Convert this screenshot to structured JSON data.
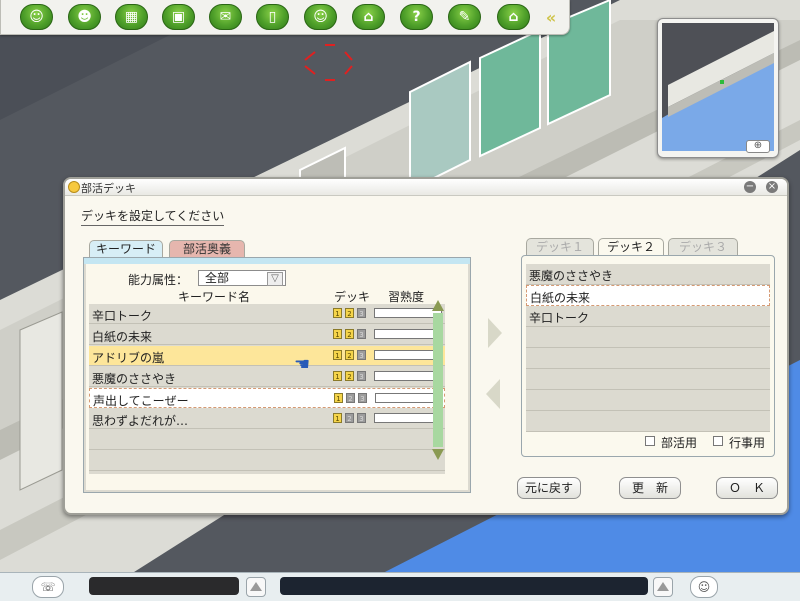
{
  "toolbar": {
    "buttons": [
      {
        "name": "student-icon",
        "glyph": "☺"
      },
      {
        "name": "person-icon",
        "glyph": "☻"
      },
      {
        "name": "clapper-icon",
        "glyph": "▦"
      },
      {
        "name": "box-icon",
        "glyph": "▣"
      },
      {
        "name": "chat-icon",
        "glyph": "✉"
      },
      {
        "name": "phone-icon",
        "glyph": "▯"
      },
      {
        "name": "pair-icon",
        "glyph": "☺"
      },
      {
        "name": "school-icon",
        "glyph": "⌂"
      },
      {
        "name": "help-icon",
        "glyph": "?"
      },
      {
        "name": "tools-icon",
        "glyph": "✎"
      },
      {
        "name": "home-icon",
        "glyph": "⌂"
      }
    ],
    "collapse_glyph": "«"
  },
  "dialog": {
    "title": "部活デッキ",
    "minimize_glyph": "−",
    "close_glyph": "×",
    "instruction": "デッキを設定してください",
    "left_tabs": {
      "keyword": "キーワード",
      "secret": "部活奥義"
    },
    "attribute_label": "能力属性：",
    "attribute_value": "全部",
    "dropdown_glyph": "▽",
    "columns": {
      "name": "キーワード名",
      "deck": "デッキ",
      "proficiency": "習熟度"
    },
    "keywords": [
      {
        "name": "辛口トーク",
        "decks": [
          true,
          true,
          false
        ]
      },
      {
        "name": "白紙の未来",
        "decks": [
          true,
          true,
          false
        ]
      },
      {
        "name": "アドリブの嵐",
        "decks": [
          true,
          true,
          false
        ]
      },
      {
        "name": "悪魔のささやき",
        "decks": [
          true,
          true,
          false
        ]
      },
      {
        "name": "声出してこーぜー",
        "decks": [
          true,
          false,
          false
        ]
      },
      {
        "name": "思わずよだれが…",
        "decks": [
          true,
          false,
          false
        ]
      }
    ],
    "badge_labels": [
      "1",
      "2",
      "3"
    ],
    "deck_tabs": [
      "デッキ１",
      "デッキ２",
      "デッキ３"
    ],
    "deck_items": [
      "悪魔のささやき",
      "白紙の未来",
      "辛口トーク"
    ],
    "checkboxes": {
      "club": "部活用",
      "event": "行事用"
    },
    "buttons": {
      "revert": "元に戻す",
      "update": "更　新",
      "ok": "Ｏ　Ｋ"
    }
  },
  "minimap": {
    "zoom_glyph": "⊕"
  },
  "bottombar": {
    "left_icon": "☏",
    "right_icon": "☺"
  }
}
